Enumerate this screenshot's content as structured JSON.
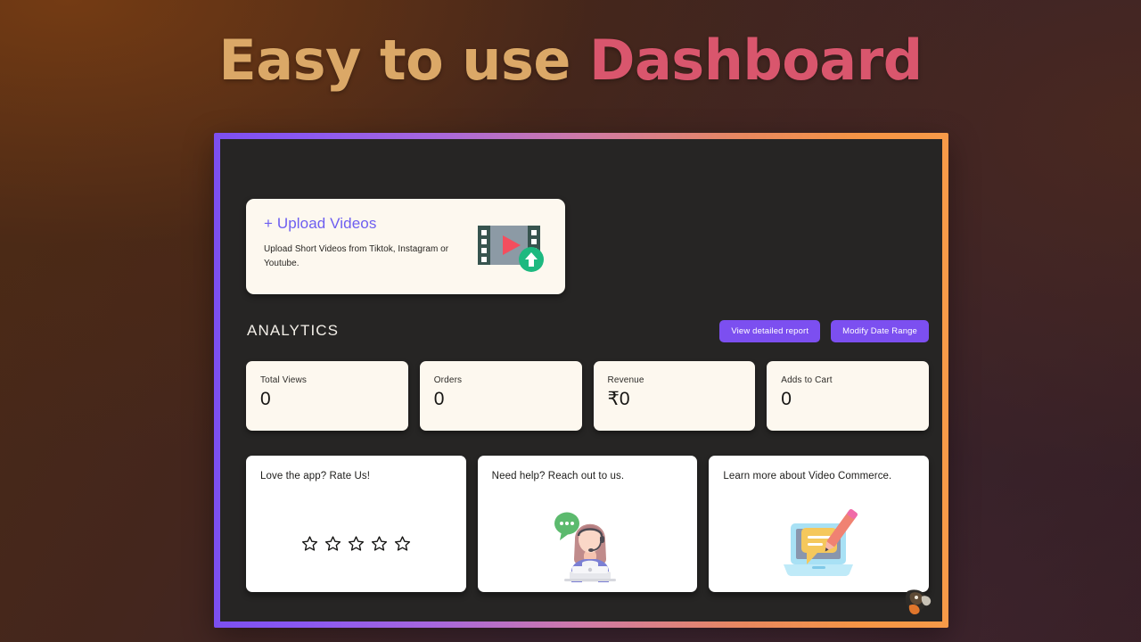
{
  "hero": {
    "title_light": "Easy to use ",
    "title_accent": "Dashboard",
    "color_light": "#dba867",
    "color_accent": "#d9566d"
  },
  "frame": {
    "gradient_start": "#7c4ff0",
    "gradient_end": "#f59545",
    "screen_bg": "#262524"
  },
  "upload_card": {
    "title": "+ Upload Videos",
    "subtitle": "Upload Short Videos from Tiktok, Instagram or Youtube.",
    "title_color": "#6d5ef0",
    "bg": "#fdf8ef",
    "icon": "video-upload-icon"
  },
  "analytics": {
    "heading": "ANALYTICS",
    "buttons": [
      {
        "label": "View detailed report",
        "name": "view-detailed-report-button"
      },
      {
        "label": "Modify Date Range",
        "name": "modify-date-range-button"
      }
    ],
    "button_color": "#7c4ff0"
  },
  "stats": [
    {
      "label": "Total Views",
      "value": "0"
    },
    {
      "label": "Orders",
      "value": "0"
    },
    {
      "label": "Revenue",
      "value": "₹0"
    },
    {
      "label": "Adds to Cart",
      "value": "0"
    }
  ],
  "promos": [
    {
      "title": "Love the app? Rate Us!",
      "icon": "star-rating",
      "stars_total": 5,
      "stars_filled": 0
    },
    {
      "title": "Need help? Reach out to us.",
      "icon": "support-agent-illustration"
    },
    {
      "title": "Learn more about Video Commerce.",
      "icon": "laptop-pencil-illustration"
    }
  ]
}
